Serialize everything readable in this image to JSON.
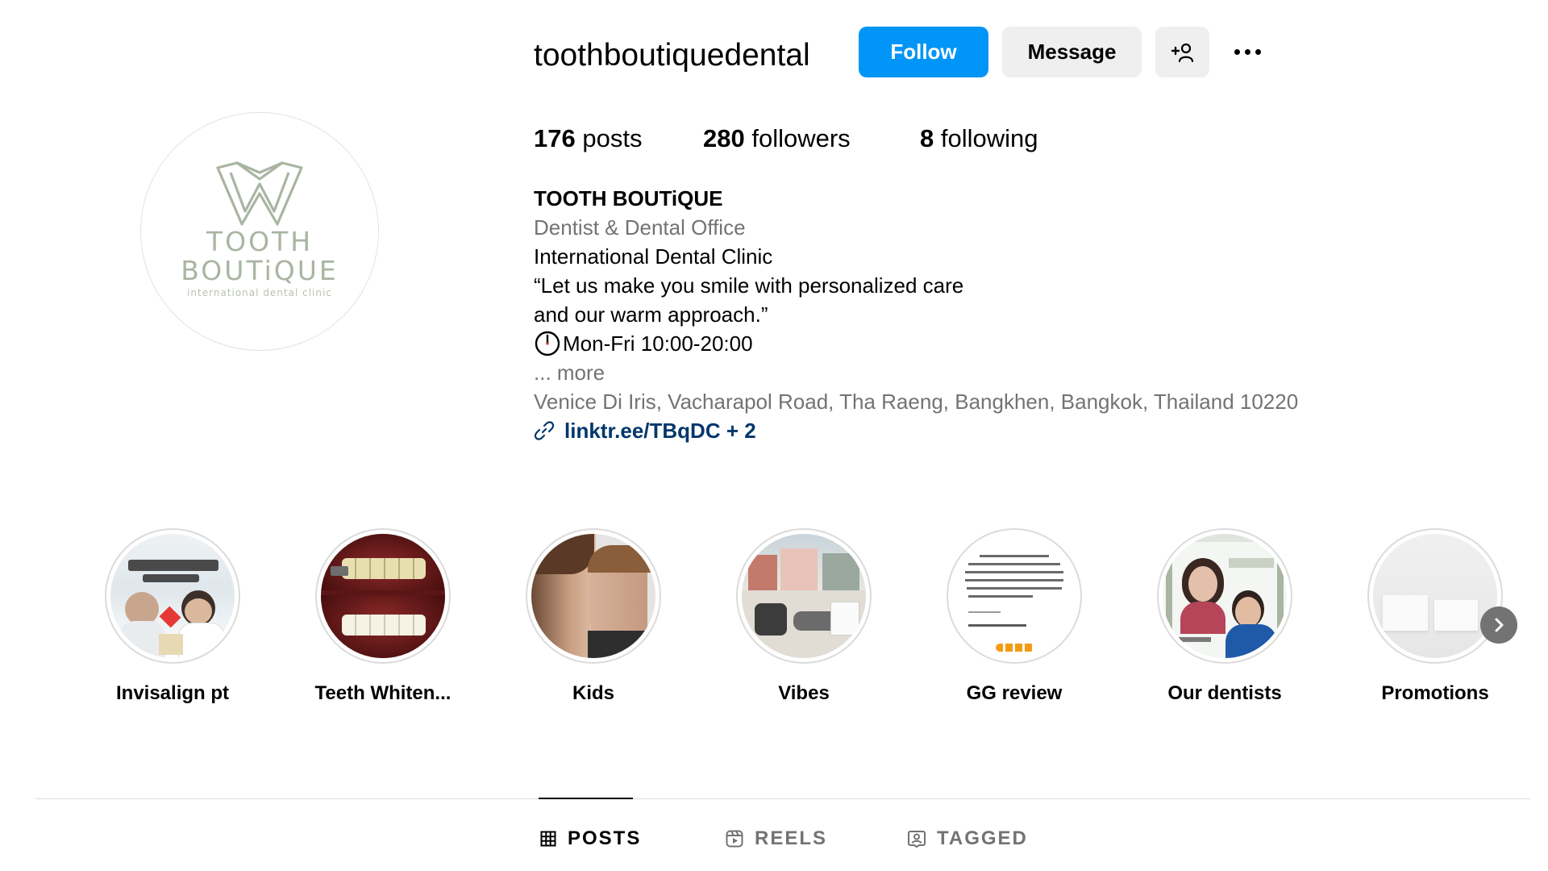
{
  "profile": {
    "username": "toothboutiquedental",
    "follow_label": "Follow",
    "message_label": "Message",
    "avatar": {
      "line1": "TOOTH",
      "line2": "BOUTiQUE",
      "tagline": "international dental clinic"
    }
  },
  "stats": {
    "posts_count": "176",
    "posts_label": "posts",
    "followers_count": "280",
    "followers_label": "followers",
    "following_count": "8",
    "following_label": "following"
  },
  "bio": {
    "name": "TOOTH BOUTiQUE",
    "category": "Dentist & Dental Office",
    "line1": "International Dental Clinic",
    "line2": "“Let us make you smile with personalized care",
    "line3": "and our warm approach.”",
    "hours": "Mon-Fri 10:00-20:00",
    "more": "... more",
    "address": "Venice Di Iris, Vacharapol Road, Tha Raeng, Bangkhen, Bangkok, Thailand 10220",
    "link": "linktr.ee/TBqDC + 2"
  },
  "highlights": [
    {
      "label": "Invisalign pt"
    },
    {
      "label": "Teeth Whiten..."
    },
    {
      "label": "Kids"
    },
    {
      "label": "Vibes"
    },
    {
      "label": "GG review"
    },
    {
      "label": "Our dentists"
    },
    {
      "label": "Promotions"
    }
  ],
  "tabs": {
    "posts": "POSTS",
    "reels": "REELS",
    "tagged": "TAGGED"
  },
  "colors": {
    "follow_button": "#0095f6",
    "secondary_button": "#efefef",
    "link": "#00376b",
    "muted_text": "#737373",
    "brand_green": "#a9b5a2"
  },
  "icons": {
    "add_person": "person-plus-icon",
    "more": "more-options-icon",
    "clock": "clock-icon",
    "link": "link-icon",
    "next": "chevron-right-icon",
    "posts_tab": "grid-icon",
    "reels_tab": "reels-icon",
    "tagged_tab": "tagged-user-icon"
  }
}
